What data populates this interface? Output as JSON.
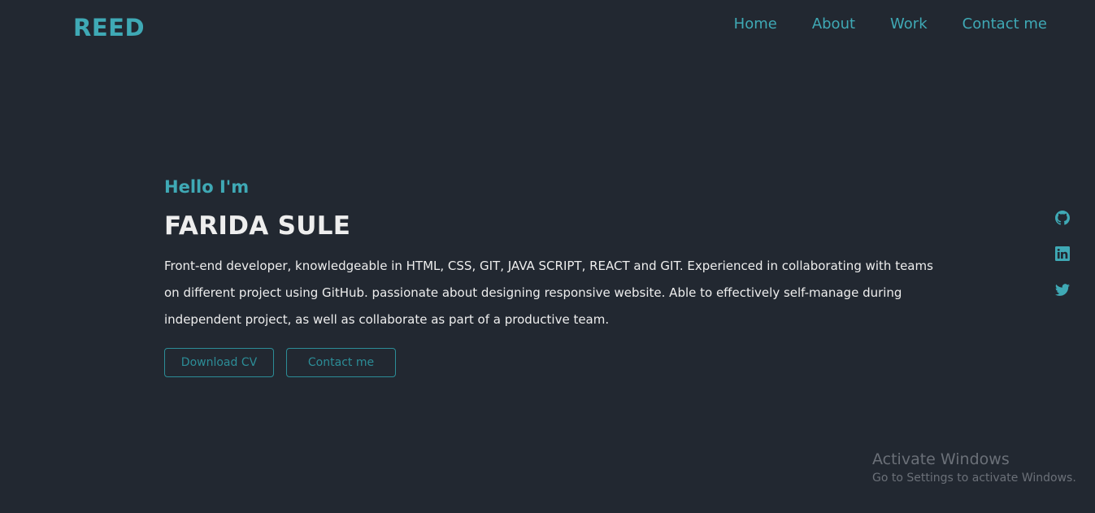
{
  "header": {
    "logo": "REED",
    "nav": [
      {
        "label": "Home"
      },
      {
        "label": "About"
      },
      {
        "label": "Work"
      },
      {
        "label": "Contact me"
      }
    ]
  },
  "hero": {
    "greeting": "Hello I'm",
    "name": "FARIDA SULE",
    "bio": "Front-end developer, knowledgeable in HTML, CSS, GIT, JAVA SCRIPT, REACT and GIT. Experienced in collaborating with teams on different project using GitHub. passionate about designing responsive website. Able to effectively self-manage during independent project, as well as collaborate as part of a productive team.",
    "buttons": {
      "download_cv": "Download CV",
      "contact": "Contact me"
    }
  },
  "socials": [
    {
      "icon": "github-icon"
    },
    {
      "icon": "linkedin-icon"
    },
    {
      "icon": "twitter-icon"
    }
  ],
  "watermark": {
    "title": "Activate Windows",
    "subtitle": "Go to Settings to activate Windows."
  },
  "colors": {
    "background": "#222831",
    "accent": "#3fa9b5",
    "text": "#eeeeee"
  }
}
